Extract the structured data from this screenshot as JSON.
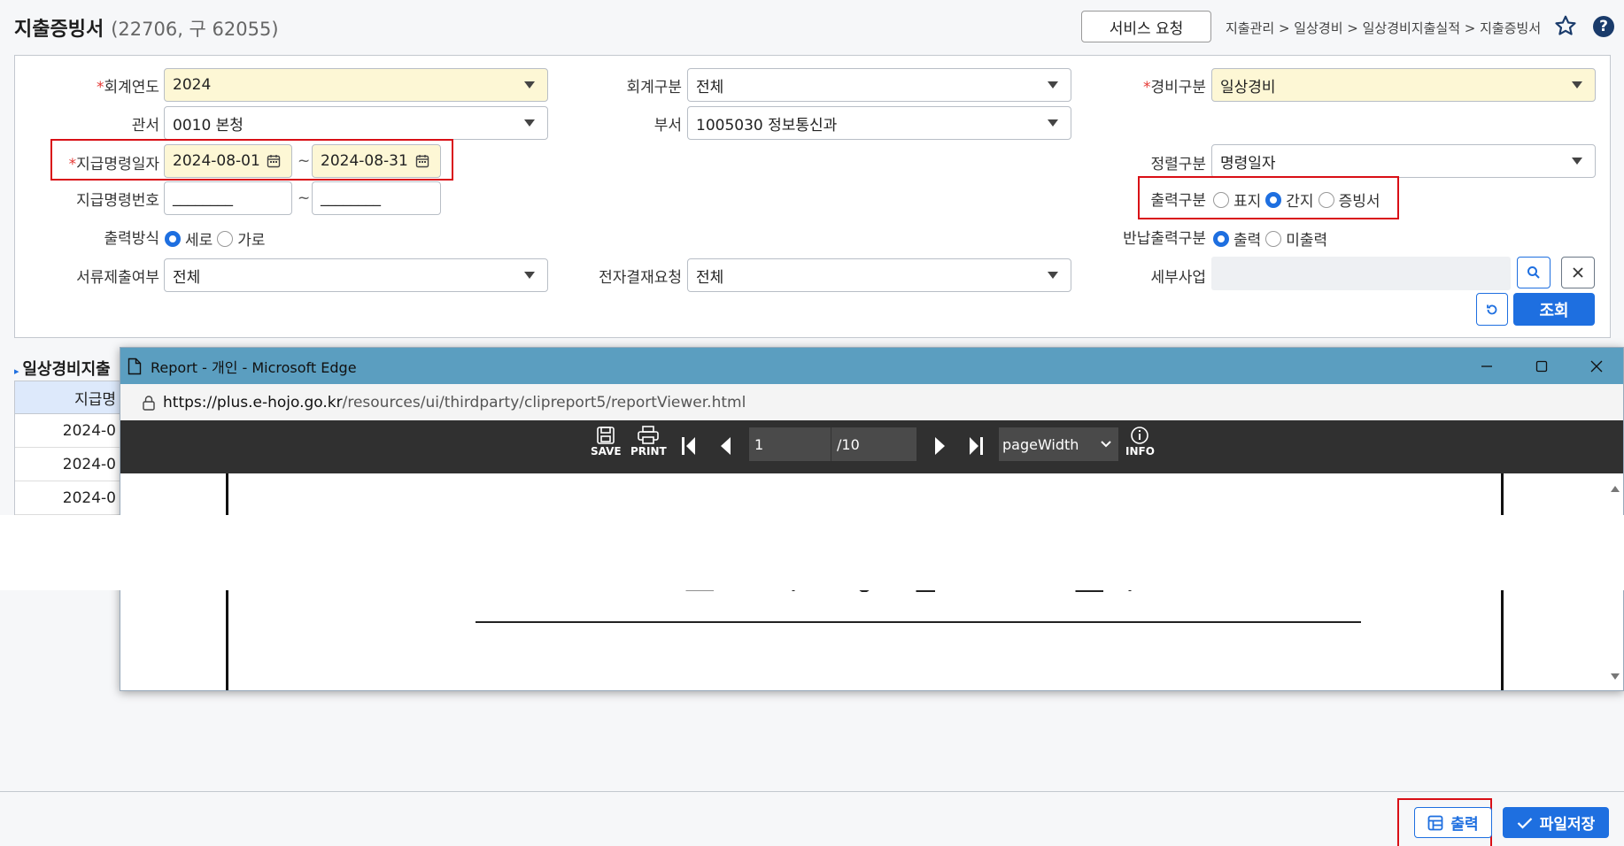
{
  "header": {
    "title": "지출증빙서",
    "subtitle": "(22706, 구 62055)",
    "service_button": "서비스 요청",
    "breadcrumb": "지출관리 > 일상경비 > 일상경비지출실적 > 지출증빙서",
    "help": "?"
  },
  "form": {
    "fiscal_year": {
      "label": "회계연도",
      "value": "2024"
    },
    "account_type": {
      "label": "회계구분",
      "value": "전체"
    },
    "expense_type": {
      "label": "경비구분",
      "value": "일상경비"
    },
    "office": {
      "label": "관서",
      "value": "0010 본청"
    },
    "department": {
      "label": "부서",
      "value": "1005030 정보통신과"
    },
    "pay_date": {
      "label": "지급명령일자",
      "from": "2024-08-01",
      "sep": "~",
      "to": "2024-08-31"
    },
    "sort": {
      "label": "정렬구분",
      "value": "명령일자"
    },
    "pay_no": {
      "label": "지급명령번호",
      "from": "________",
      "sep": "~",
      "to": "________"
    },
    "output_type": {
      "label": "출력구분",
      "options": [
        "표지",
        "간지",
        "증빙서"
      ],
      "selected": "간지"
    },
    "output_method": {
      "label": "출력방식",
      "options": [
        "세로",
        "가로"
      ],
      "selected": "세로"
    },
    "return_output": {
      "label": "반납출력구분",
      "options": [
        "출력",
        "미출력"
      ],
      "selected": "출력"
    },
    "doc_submit": {
      "label": "서류제출여부",
      "value": "전체"
    },
    "e_approval": {
      "label": "전자결재요청",
      "value": "전체"
    },
    "sub_project": {
      "label": "세부사업",
      "value": ""
    },
    "query_button": "조회"
  },
  "table": {
    "section_title": "일상경비지출",
    "header": "지급명",
    "rows": [
      "2024-0",
      "2024-0",
      "2024-0"
    ]
  },
  "popup": {
    "title": "Report - 개인 - Microsoft Edge",
    "url_host": "https://plus.e-hojo.go.kr",
    "url_path": "/resources/ui/thirdparty/clipreport5/reportViewer.html",
    "save_label": "SAVE",
    "print_label": "PRINT",
    "info_label": "INFO",
    "page_current": "1",
    "page_total": "/10",
    "zoom": "pageWidth"
  },
  "footer": {
    "print_button": "출력",
    "save_button": "파일저장"
  }
}
